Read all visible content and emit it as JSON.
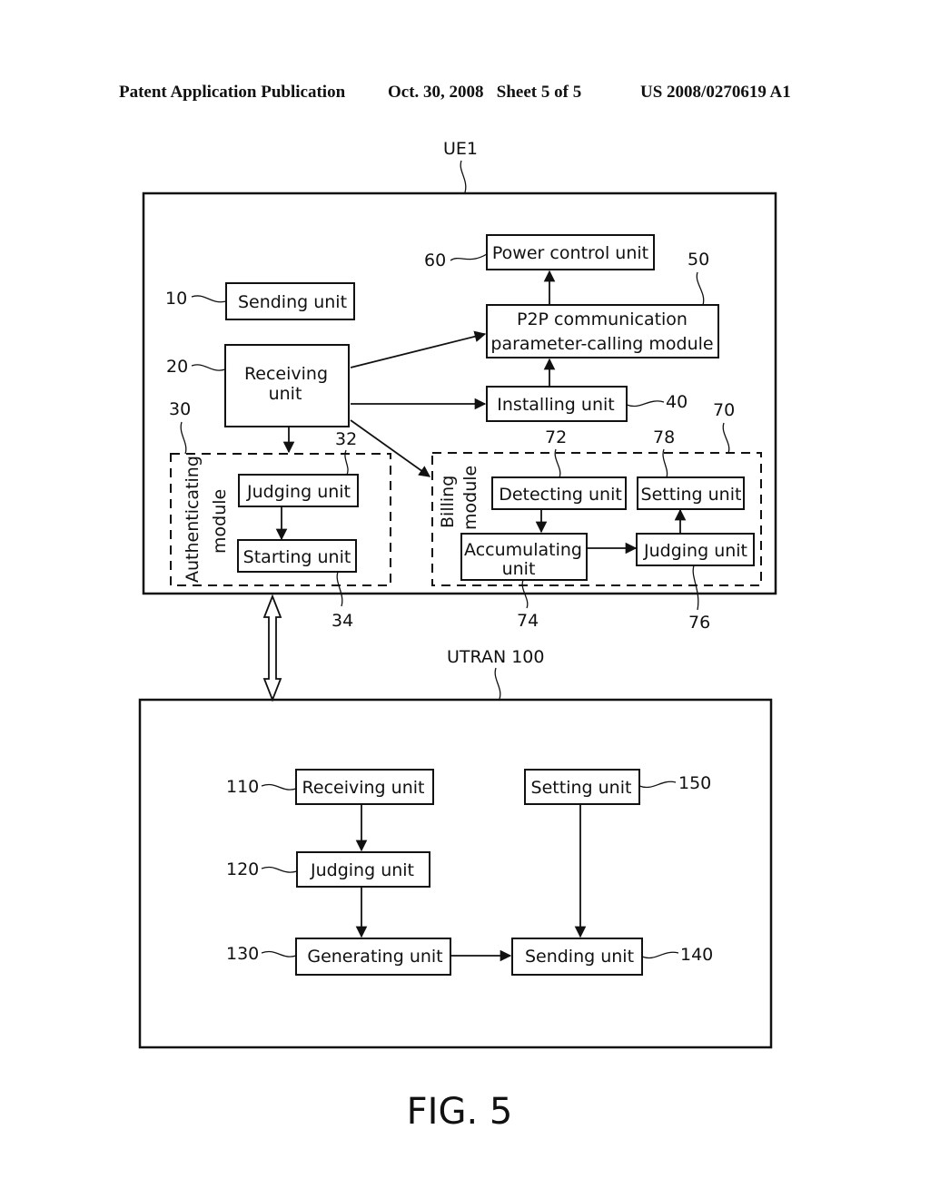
{
  "header": {
    "publication": "Patent Application Publication",
    "date_sheet": "Oct. 30, 2008   Sheet 5 of 5",
    "number": "US 2008/0270619 A1"
  },
  "ue": {
    "title": "UE1",
    "sending_unit": {
      "ref": "10",
      "label": "Sending unit"
    },
    "receiving_unit": {
      "ref": "20",
      "line1": "Receiving",
      "line2": "unit"
    },
    "power_control_unit": {
      "ref": "60",
      "label": "Power control unit"
    },
    "p2p_module": {
      "ref": "50",
      "line1": "P2P communication",
      "line2": "parameter-calling module"
    },
    "installing_unit": {
      "ref": "40",
      "label": "Installing unit"
    },
    "authenticating_module": {
      "ref": "30",
      "line1": "Authenticating",
      "line2": "module",
      "judging_unit": {
        "ref": "32",
        "label": "Judging unit"
      },
      "starting_unit": {
        "ref": "34",
        "label": "Starting unit"
      }
    },
    "billing_module": {
      "ref": "70",
      "line1": "Billing",
      "line2": "module",
      "detecting_unit": {
        "ref": "72",
        "label": "Detecting unit"
      },
      "setting_unit": {
        "ref": "78",
        "label": "Setting unit"
      },
      "accumulating_unit": {
        "ref": "74",
        "line1": "Accumulating",
        "line2": "unit"
      },
      "judging_unit": {
        "ref": "76",
        "label": "Judging unit"
      }
    }
  },
  "utran": {
    "title": "UTRAN 100",
    "receiving_unit": {
      "ref": "110",
      "label": "Receiving unit"
    },
    "judging_unit": {
      "ref": "120",
      "label": "Judging unit"
    },
    "generating_unit": {
      "ref": "130",
      "label": "Generating unit"
    },
    "sending_unit": {
      "ref": "140",
      "label": "Sending unit"
    },
    "setting_unit": {
      "ref": "150",
      "label": "Setting unit"
    }
  },
  "figure_label": "FIG. 5"
}
